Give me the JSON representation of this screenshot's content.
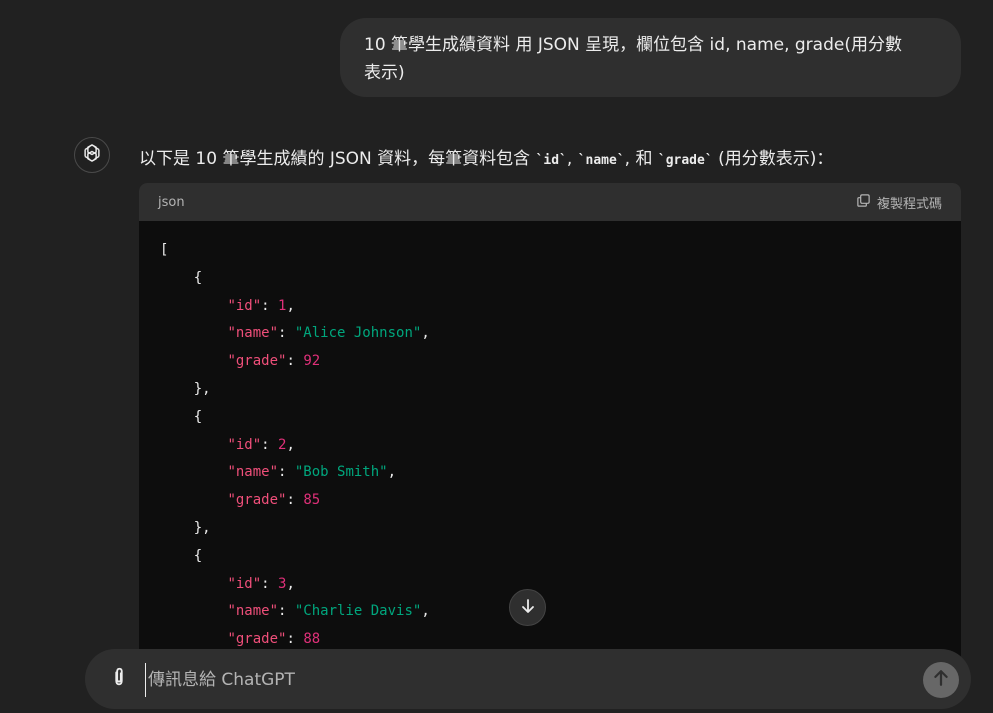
{
  "user_message": {
    "line1": "10 筆學生成績資料 用 JSON 呈現，欄位包含 id, name, grade(用分數",
    "line2": "表示)"
  },
  "assistant": {
    "intro_prefix": "以下是 10 筆學生成績的 JSON 資料，每筆資料包含 ",
    "field_id": "`id`",
    "sep1": ", ",
    "field_name": "`name`",
    "sep2": ", 和 ",
    "field_grade": "`grade`",
    "intro_suffix": " (用分數表示)："
  },
  "code_block": {
    "language": "json",
    "copy_label": "複製程式碼",
    "records": [
      {
        "id": "1",
        "name": "\"Alice Johnson\"",
        "grade": "92"
      },
      {
        "id": "2",
        "name": "\"Bob Smith\"",
        "grade": "85"
      },
      {
        "id": "3",
        "name": "\"Charlie Davis\"",
        "grade": "88"
      }
    ],
    "key_id": "\"id\"",
    "key_name": "\"name\"",
    "key_grade": "\"grade\""
  },
  "composer": {
    "placeholder": "傳訊息給 ChatGPT"
  },
  "icons": {
    "avatar": "openai-logo-icon",
    "copy": "copy-icon",
    "scroll": "arrow-down-icon",
    "attach": "paperclip-icon",
    "send": "arrow-up-icon"
  }
}
